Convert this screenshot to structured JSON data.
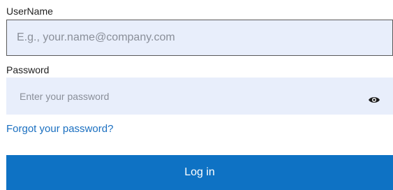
{
  "username": {
    "label": "UserName",
    "placeholder": "E.g., your.name@company.com",
    "value": ""
  },
  "password": {
    "label": "Password",
    "placeholder": "Enter your password",
    "value": "",
    "toggle_icon": "eye-icon"
  },
  "links": {
    "forgot": "Forgot your password?"
  },
  "buttons": {
    "login": "Log in"
  },
  "colors": {
    "field_bg": "#e8eefb",
    "link": "#1a6fc0",
    "primary": "#0e72c4"
  }
}
